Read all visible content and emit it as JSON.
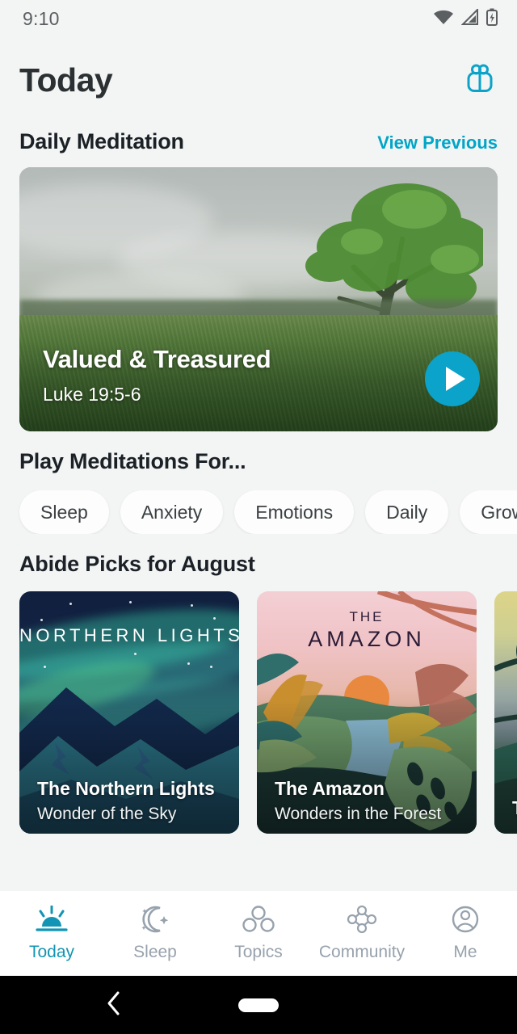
{
  "status_bar": {
    "time": "9:10",
    "icons": [
      "wifi-icon",
      "cellular-signal-icon",
      "battery-charging-icon"
    ]
  },
  "header": {
    "title": "Today",
    "gift_icon": "gift-icon"
  },
  "daily_meditation": {
    "section_title": "Daily Meditation",
    "view_previous_label": "View Previous",
    "card": {
      "title": "Valued & Treasured",
      "reference": "Luke 19:5-6",
      "play_icon": "play-icon",
      "image_description": "green tree in a grass field under overcast sky"
    }
  },
  "play_meditations": {
    "section_title": "Play Meditations For...",
    "chips": [
      "Sleep",
      "Anxiety",
      "Emotions",
      "Daily",
      "Grow Sp"
    ]
  },
  "abide_picks": {
    "section_title": "Abide Picks for August",
    "cards": [
      {
        "art_label_top": "",
        "art_label": "NORTHERN LIGHTS",
        "title": "The Northern Lights",
        "subtitle": "Wonder of the Sky"
      },
      {
        "art_label_top": "THE",
        "art_label": "AMAZON",
        "title": "The Amazon",
        "subtitle": "Wonders in the Forest"
      },
      {
        "art_label_top": "",
        "art_label": "",
        "title": "T",
        "subtitle": ""
      }
    ]
  },
  "bottom_nav": {
    "items": [
      {
        "label": "Today",
        "icon": "sunrise-icon",
        "active": true
      },
      {
        "label": "Sleep",
        "icon": "moon-stars-icon",
        "active": false
      },
      {
        "label": "Topics",
        "icon": "three-circles-icon",
        "active": false
      },
      {
        "label": "Community",
        "icon": "community-diamond-icon",
        "active": false
      },
      {
        "label": "Me",
        "icon": "person-circle-icon",
        "active": false
      }
    ]
  },
  "android_nav": {
    "back_icon": "back-chevron-icon",
    "home_icon": "home-pill-icon"
  },
  "colors": {
    "accent": "#0ba3c9",
    "link": "#00a5c8",
    "background": "#f3f4f4",
    "title": "#2b3032",
    "nav_inactive": "#97a2ad",
    "nav_active": "#1295b5"
  }
}
